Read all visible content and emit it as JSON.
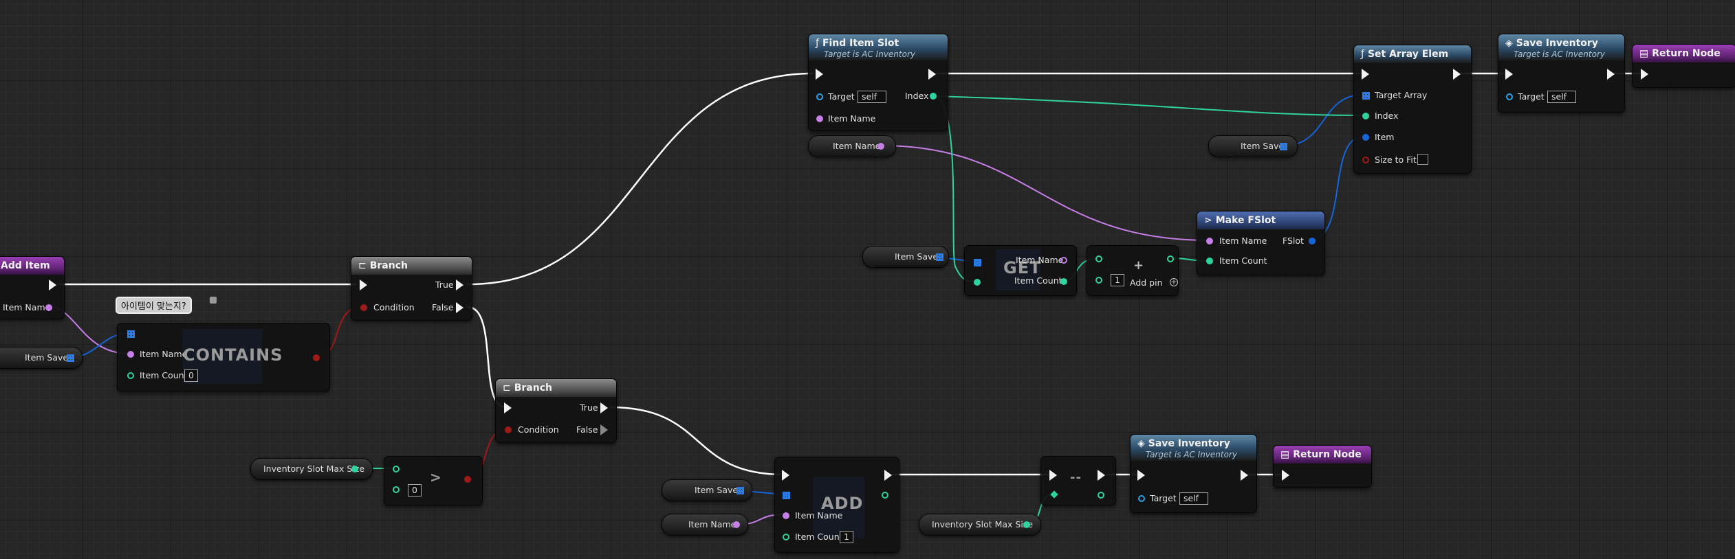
{
  "nodes": {
    "add_item": {
      "title": "Add Item",
      "pin_item_name": "Item Name"
    },
    "var_item_save_1": "Item Save",
    "comment": "아이템이 맞는지?",
    "contains": {
      "title": "CONTAINS",
      "pin_item_name": "Item Name",
      "pin_item_count": "Item Count",
      "item_count_value": "0"
    },
    "branch_1": {
      "title": "Branch",
      "pin_condition": "Condition",
      "pin_true": "True",
      "pin_false": "False"
    },
    "branch_2": {
      "title": "Branch",
      "pin_condition": "Condition",
      "pin_true": "True",
      "pin_false": "False"
    },
    "var_slot_max_1": "Inventory Slot Max Size",
    "greater": {
      "symbol": ">",
      "value": "0"
    },
    "find_item_slot": {
      "title": "Find Item Slot",
      "subtitle": "Target is AC Inventory",
      "pin_target": "Target",
      "target_value": "self",
      "pin_item_name": "Item Name",
      "pin_index": "Index"
    },
    "var_item_name_1": "Item Name",
    "var_item_save_2": "Item Save",
    "get": {
      "title": "GET",
      "pin_item_name": "Item Name",
      "pin_item_count": "Item Count"
    },
    "add_int": {
      "value": "1",
      "add_pin": "Add pin"
    },
    "make_fslot": {
      "title": "Make FSlot",
      "pin_item_name": "Item Name",
      "pin_item_count": "Item Count",
      "pin_fslot": "FSlot"
    },
    "var_item_save_3": "Item Save",
    "set_array_elem": {
      "title": "Set Array Elem",
      "pin_target_array": "Target Array",
      "pin_index": "Index",
      "pin_item": "Item",
      "pin_size_to_fit": "Size to Fit"
    },
    "save_inventory_1": {
      "title": "Save Inventory",
      "subtitle": "Target is AC Inventory",
      "pin_target": "Target",
      "target_value": "self"
    },
    "return_node_1": {
      "title": "Return Node"
    },
    "var_item_save_4": "Item Save",
    "var_item_name_2": "Item Name",
    "add_array": {
      "title": "ADD",
      "pin_item_name": "Item Name",
      "pin_item_count": "Item Count",
      "item_count_value": "1"
    },
    "decrement": {
      "symbol": "--"
    },
    "var_slot_max_2": "Inventory Slot Max Size",
    "save_inventory_2": {
      "title": "Save Inventory",
      "subtitle": "Target is AC Inventory",
      "pin_target": "Target",
      "target_value": "self"
    },
    "return_node_2": {
      "title": "Return Node"
    }
  },
  "colors": {
    "exec": "#ffffff",
    "name_pin": "#c77fe8",
    "int_pin": "#2fd3a0",
    "struct_pin": "#1565d8",
    "bool_pin": "#a01a1a",
    "object_pin": "#2aa3e8",
    "graph_bg": "#262626"
  }
}
